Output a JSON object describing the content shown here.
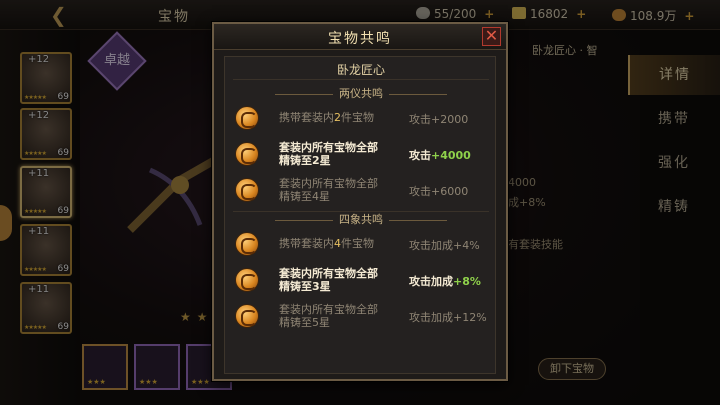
{
  "topbar": {
    "title": "宝物",
    "back_icon": "back-arrow-icon",
    "resources": [
      {
        "icon": "stamina-icon",
        "value": "55/200",
        "color": "#b9b2a6"
      },
      {
        "icon": "ingot-icon",
        "value": "16802",
        "color": "#e2c25a"
      },
      {
        "icon": "coin-icon",
        "value": "108.9万",
        "color": "#c98a3a"
      }
    ]
  },
  "heroes": [
    {
      "level": "+12",
      "count": "69"
    },
    {
      "level": "+12",
      "count": "69"
    },
    {
      "level": "+11",
      "count": "69"
    },
    {
      "level": "+11",
      "count": "69"
    },
    {
      "level": "+11",
      "count": "69"
    }
  ],
  "stage": {
    "quality_label": "卓越",
    "set_label": "卧龙匠心 · 智",
    "bg_line1": "4000",
    "bg_line2": "成+8%",
    "bg_line3": "有套装技能",
    "unequip": "卸下宝物"
  },
  "right_nav": [
    "详情",
    "携带",
    "强化",
    "精铸"
  ],
  "modal": {
    "title": "宝物共鸣",
    "set_name": "卧龙匠心",
    "sections": [
      {
        "title": "两仪共鸣",
        "rows": [
          {
            "pre": "携带套装内",
            "hl": "2",
            "post": "件宝物",
            "line2": "",
            "active": false,
            "bonus_pre": "攻击",
            "bonus_val": "+2000"
          },
          {
            "pre": "套装内所有宝物全部",
            "hl": "",
            "post": "",
            "line2": "精铸至2星",
            "active": true,
            "bonus_pre": "攻击",
            "bonus_val": "+4000"
          },
          {
            "pre": "套装内所有宝物全部",
            "hl": "",
            "post": "",
            "line2": "精铸至4星",
            "active": false,
            "bonus_pre": "攻击",
            "bonus_val": "+6000"
          }
        ]
      },
      {
        "title": "四象共鸣",
        "rows": [
          {
            "pre": "携带套装内",
            "hl": "4",
            "post": "件宝物",
            "line2": "",
            "active": false,
            "bonus_pre": "攻击加成",
            "bonus_val": "+4%"
          },
          {
            "pre": "套装内所有宝物全部",
            "hl": "",
            "post": "",
            "line2": "精铸至3星",
            "active": true,
            "bonus_pre": "攻击加成",
            "bonus_val": "+8%"
          },
          {
            "pre": "套装内所有宝物全部",
            "hl": "",
            "post": "",
            "line2": "精铸至5星",
            "active": false,
            "bonus_pre": "攻击加成",
            "bonus_val": "+12%"
          }
        ]
      }
    ]
  }
}
